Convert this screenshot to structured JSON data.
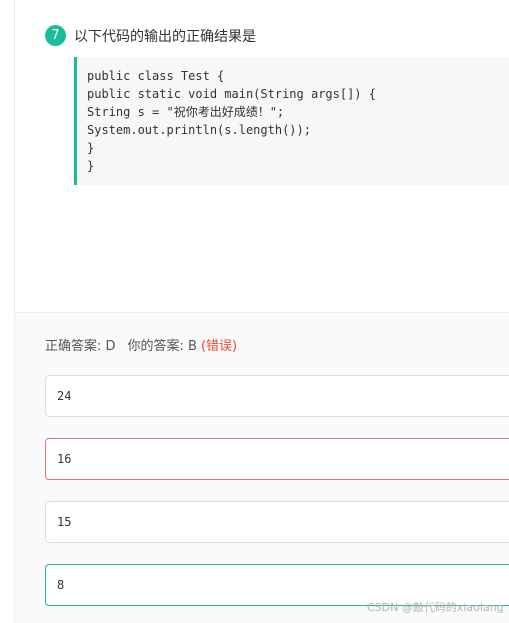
{
  "question": {
    "number": "7",
    "title": "以下代码的输出的正确结果是"
  },
  "code_lines": [
    "public class Test {",
    "public static void main(String args[]) {",
    "String s = \"祝你考出好成绩！\";",
    "System.out.println(s.length());",
    "}",
    "}"
  ],
  "answer": {
    "correct_label": "正确答案: D",
    "your_label": "你的答案: B",
    "status": "(错误)"
  },
  "options": [
    {
      "value": "24",
      "state": "normal"
    },
    {
      "value": "16",
      "state": "chosen-wrong"
    },
    {
      "value": "15",
      "state": "normal"
    },
    {
      "value": "8",
      "state": "correct"
    }
  ],
  "watermark": "CSDN @敲代码的xiaolang",
  "colors": {
    "accent": "#1abc9c",
    "error": "#e74c3c",
    "wrong_border": "#e57373"
  }
}
